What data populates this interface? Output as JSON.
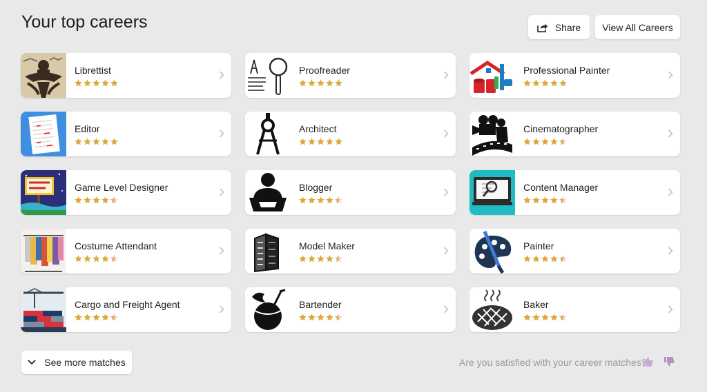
{
  "page": {
    "title": "Your top careers"
  },
  "header": {
    "share_label": "Share",
    "view_all_label": "View All Careers"
  },
  "careers": [
    {
      "name": "Librettist",
      "rating": 5,
      "icon": "librettist-image"
    },
    {
      "name": "Proofreader",
      "rating": 5,
      "icon": "magnifier-text-icon"
    },
    {
      "name": "Professional Painter",
      "rating": 5,
      "icon": "house-paint-icon"
    },
    {
      "name": "Editor",
      "rating": 5,
      "icon": "document-icon"
    },
    {
      "name": "Architect",
      "rating": 5,
      "icon": "compass-icon"
    },
    {
      "name": "Cinematographer",
      "rating": 4.5,
      "icon": "film-camera-icon"
    },
    {
      "name": "Game Level Designer",
      "rating": 4.5,
      "icon": "level-up-sign-icon"
    },
    {
      "name": "Blogger",
      "rating": 4.5,
      "icon": "person-laptop-icon"
    },
    {
      "name": "Content Manager",
      "rating": 4.5,
      "icon": "monitor-search-icon"
    },
    {
      "name": "Costume Attendant",
      "rating": 4.5,
      "icon": "clothes-rack-icon"
    },
    {
      "name": "Model Maker",
      "rating": 4.5,
      "icon": "building-model-icon"
    },
    {
      "name": "Painter",
      "rating": 4.5,
      "icon": "palette-brush-icon"
    },
    {
      "name": "Cargo and Freight Agent",
      "rating": 4.5,
      "icon": "cargo-crane-icon"
    },
    {
      "name": "Bartender",
      "rating": 4.5,
      "icon": "coconut-drink-icon"
    },
    {
      "name": "Baker",
      "rating": 4.5,
      "icon": "bread-loaf-icon"
    }
  ],
  "footer": {
    "see_more_label": "See more matches",
    "satisfaction_question": "Are you satisfied with your career matches?"
  },
  "colors": {
    "star": "#e0a83a",
    "star_empty": "#dcdcdc",
    "thumb_up": "#c7a9cf",
    "thumb_down": "#b890c2"
  }
}
